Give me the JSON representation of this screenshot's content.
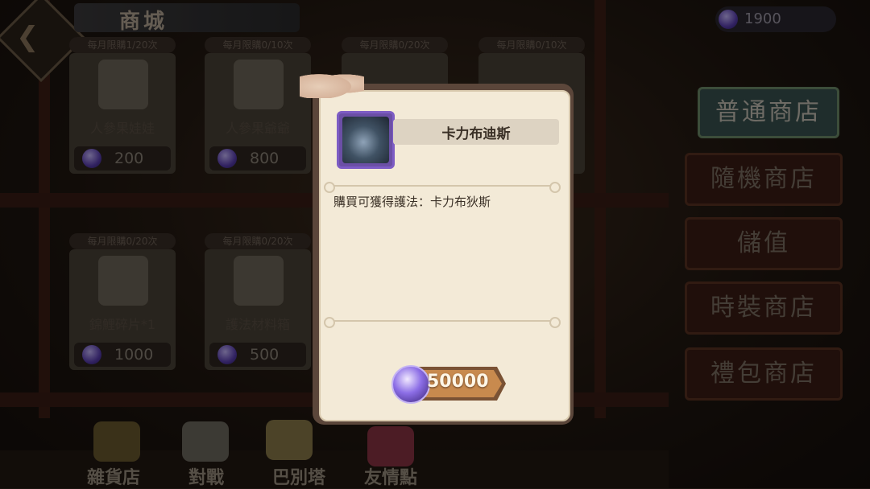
{
  "header": {
    "title": "商城",
    "currency_value": "1900"
  },
  "shop_items": [
    {
      "limit": "每月限購1/20次",
      "name": "人參果娃娃",
      "price": "200"
    },
    {
      "limit": "每月限購0/10次",
      "name": "人參果爺爺",
      "price": "800"
    },
    {
      "limit": "每月限購0/20次",
      "name": "",
      "price": ""
    },
    {
      "limit": "每月限購0/10次",
      "name": "",
      "price": ""
    },
    {
      "limit": "每月限購0/20次",
      "name": "錦鯉碎片*1",
      "price": "1000"
    },
    {
      "limit": "每月限購0/20次",
      "name": "護法材料箱",
      "price": "500"
    }
  ],
  "menu": [
    "普通商店",
    "隨機商店",
    "儲值",
    "時裝商店",
    "禮包商店"
  ],
  "bottom_nav": [
    "雜貨店",
    "對戰",
    "巴別塔",
    "友情點"
  ],
  "modal": {
    "item_name": "卡力布迪斯",
    "description": "購買可獲得護法：卡力布狄斯",
    "price": "50000"
  },
  "colors": {
    "gem": "#6b4fd0",
    "modal_bg": "#f3ead7",
    "active_menu": "#3a5250"
  }
}
